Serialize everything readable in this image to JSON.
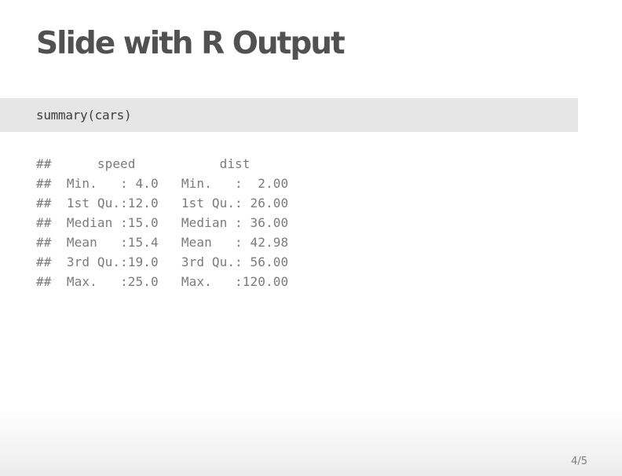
{
  "slide": {
    "title": "Slide with R Output",
    "code": "summary(cars)",
    "output_lines": [
      "##      speed           dist       ",
      "##  Min.   : 4.0   Min.   :  2.00  ",
      "##  1st Qu.:12.0   1st Qu.: 26.00  ",
      "##  Median :15.0   Median : 36.00  ",
      "##  Mean   :15.4   Mean   : 42.98  ",
      "##  3rd Qu.:19.0   3rd Qu.: 56.00  ",
      "##  Max.   :25.0   Max.   :120.00  "
    ],
    "page_number": "4/5"
  },
  "colors": {
    "title": "#515151",
    "code_background": "#e6e6e6",
    "output_text": "#7b7b7b"
  }
}
